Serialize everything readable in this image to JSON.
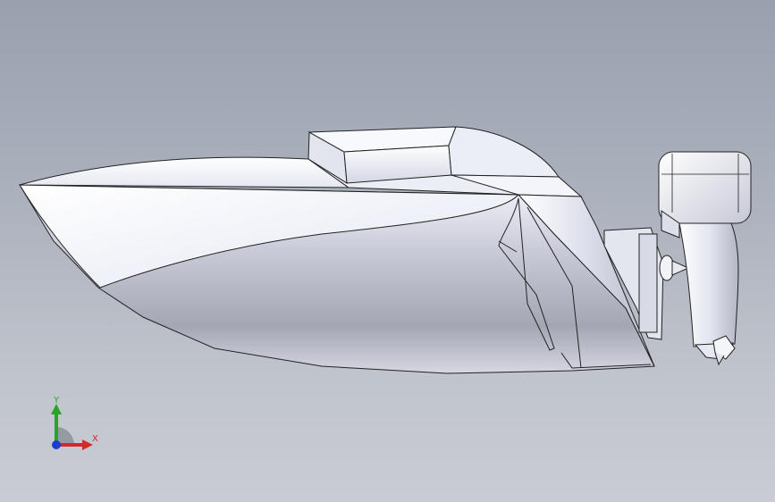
{
  "viewport": {
    "background_top": "#9aa0ad",
    "background_bottom": "#c9ccd3",
    "model": "speedboat-with-outboard-motor"
  },
  "triad": {
    "y_label": "Y",
    "x_label": "X",
    "y_color": "#2aa32a",
    "x_color": "#d12a2a",
    "z_color": "#1a3fd1"
  }
}
